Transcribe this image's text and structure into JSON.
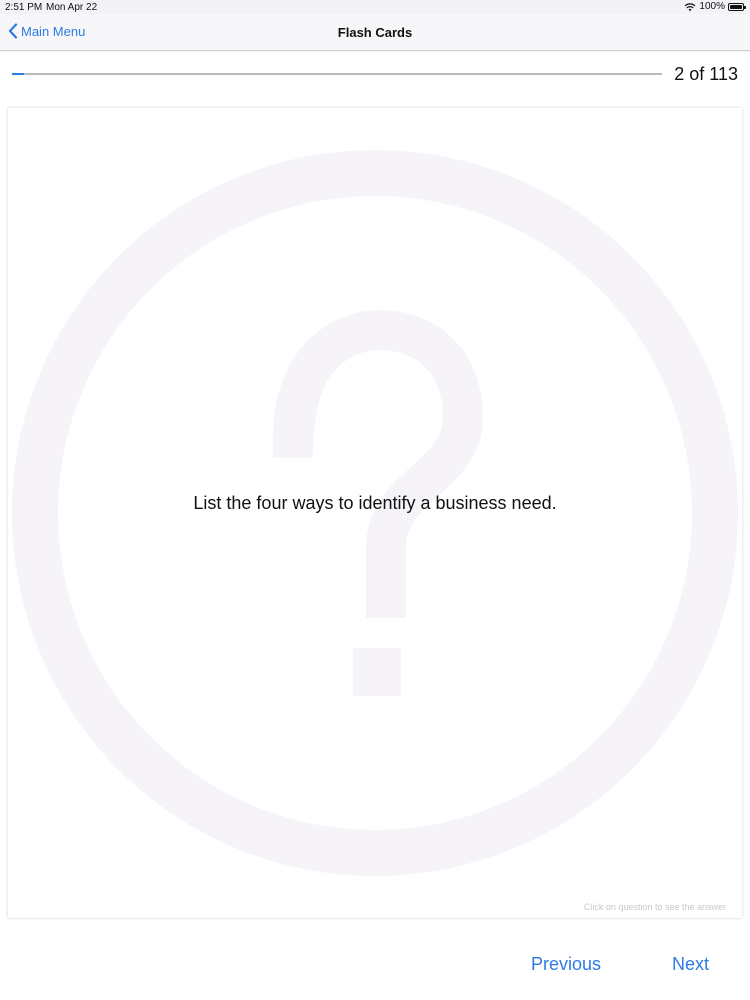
{
  "status_bar": {
    "time": "2:51 PM",
    "date": "Mon Apr 22",
    "battery": "100%",
    "icons": [
      "wifi-icon",
      "battery-icon"
    ]
  },
  "nav": {
    "back_label": "Main Menu",
    "back_icon": "chevron-left-icon",
    "title": "Flash Cards"
  },
  "progress": {
    "current": 2,
    "total": 113,
    "label": "2 of 113",
    "fraction": 0.0177
  },
  "card": {
    "question": "List the four ways to identify a business need.",
    "hint": "Click on question to see the answer",
    "watermark_icon": "question-mark-icon"
  },
  "footer": {
    "previous_label": "Previous",
    "next_label": "Next"
  },
  "colors": {
    "accent": "#2c7be5",
    "watermark": "#f6f4f8"
  }
}
